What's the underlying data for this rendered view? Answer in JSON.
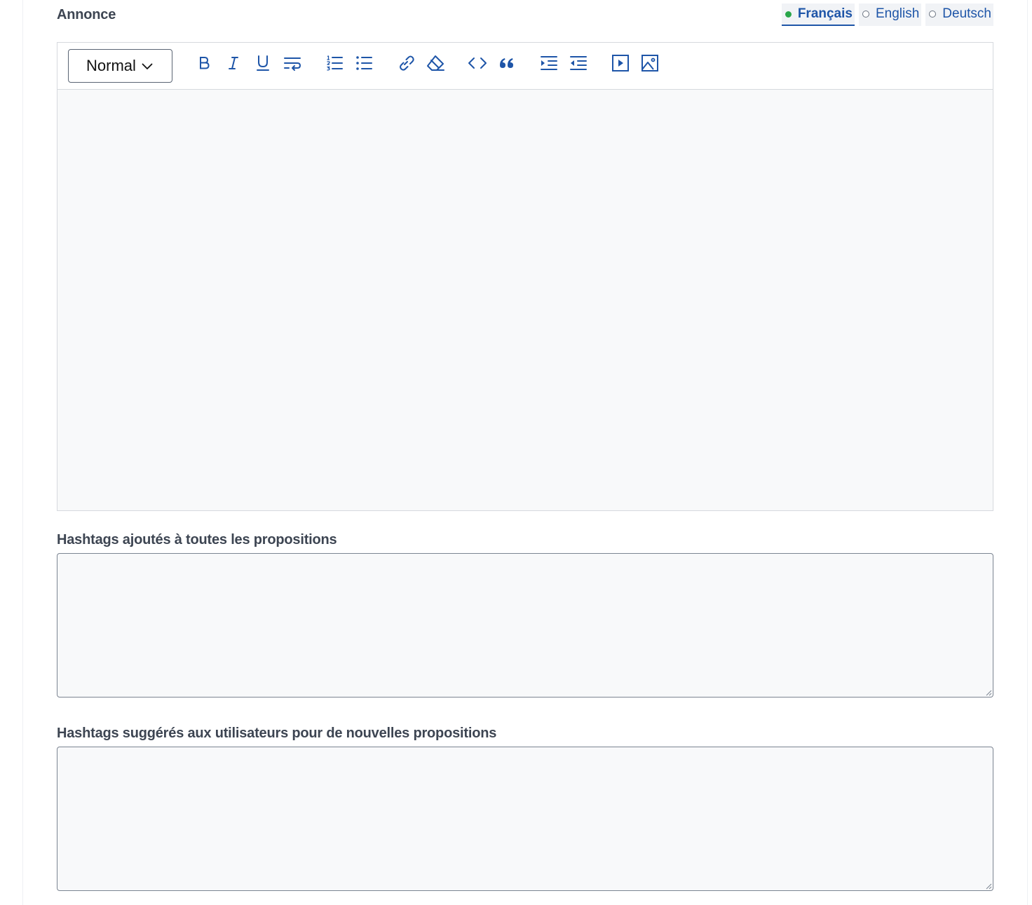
{
  "announcement": {
    "label": "Annonce",
    "languages": [
      {
        "label": "Français",
        "active": true
      },
      {
        "label": "English",
        "active": false
      },
      {
        "label": "Deutsch",
        "active": false
      }
    ],
    "active_dot_color": "#2aa64a"
  },
  "editor": {
    "heading_select": "Normal",
    "toolbar_icons": [
      "bold-icon",
      "italic-icon",
      "underline-icon",
      "hard-break-icon",
      "ordered-list-icon",
      "bullet-list-icon",
      "link-icon",
      "clear-formatting-icon",
      "code-block-icon",
      "blockquote-icon",
      "indent-icon",
      "outdent-icon",
      "video-icon",
      "image-icon"
    ],
    "content": ""
  },
  "automatic_hashtags": {
    "label": "Hashtags ajoutés à toutes les propositions",
    "value": ""
  },
  "suggested_hashtags": {
    "label": "Hashtags suggérés aux utilisateurs pour de nouvelles propositions",
    "value": ""
  },
  "colors": {
    "accent": "#1e55a8",
    "label_text": "#3d4552",
    "field_bg": "#f8f9fa"
  }
}
